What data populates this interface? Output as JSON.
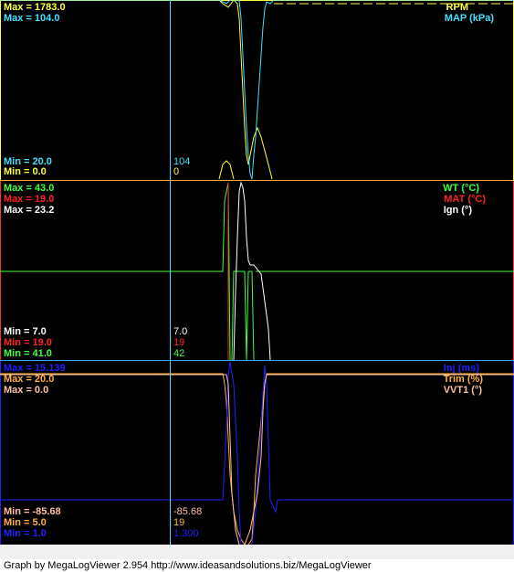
{
  "colors": {
    "rpm": "#ffff40",
    "map": "#40e0ff",
    "wt": "#40ff40",
    "mat": "#ff2020",
    "ign": "#ffffff",
    "inj": "#2020ff",
    "trim": "#ffb040",
    "vvt": "#ffc0a0",
    "frame": "#ffff40",
    "cursor": "#40e0ff"
  },
  "panel1": {
    "max_rpm": "Max = 1783.0",
    "max_map": "Max = 104.0",
    "min_map": "Min = 20.0",
    "min_rpm": "Min = 0.0",
    "legend_rpm": "RPM",
    "legend_map": "MAP (kPa)",
    "cursor_map": "104",
    "cursor_rpm": "0"
  },
  "panel2": {
    "max_wt": "Max = 43.0",
    "max_mat": "Max = 19.0",
    "max_ign": "Max = 23.2",
    "min_ign": "Min = 7.0",
    "min_mat": "Min = 19.0",
    "min_wt": "Min = 41.0",
    "legend_wt": "WT (°C)",
    "legend_mat": "MAT (°C)",
    "legend_ign": "Ign (°)",
    "cursor_ign": "7.0",
    "cursor_mat": "19",
    "cursor_wt": "42"
  },
  "panel3": {
    "max_inj": "Max = 15.139",
    "max_trim": "Max = 20.0",
    "max_vvt": "Max = 0.0",
    "min_vvt": "Min = -85.68",
    "min_trim": "Min = 5.0",
    "min_inj": "Min = 1.0",
    "legend_inj": "Inj (ms)",
    "legend_trim": "Trim (%)",
    "legend_vvt": "VVT1 (°)",
    "cursor_vvt": "-85.68",
    "cursor_trim": "19",
    "cursor_inj": "1.300"
  },
  "footer": {
    "text": "Graph by MegaLogViewer 2.954 http://www.ideasandsolutions.biz/MegaLogViewer"
  }
}
